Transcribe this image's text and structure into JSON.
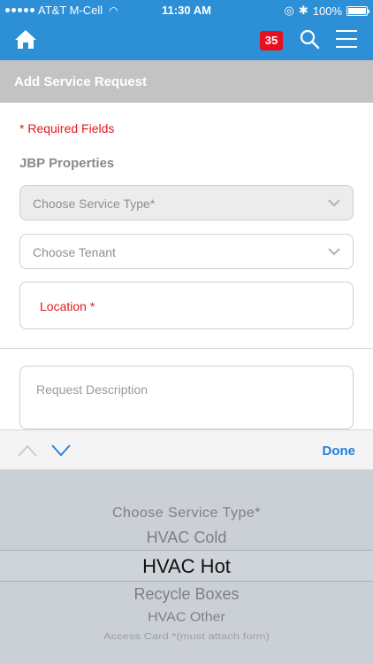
{
  "status_bar": {
    "carrier": "AT&T M-Cell",
    "time": "11:30 AM",
    "battery": "100%"
  },
  "header": {
    "notification_count": "35"
  },
  "title_bar": {
    "title": "Add Service Request"
  },
  "form": {
    "required_note": "* Required Fields",
    "company": "JBP Properties",
    "service_type_placeholder": "Choose Service Type*",
    "tenant_placeholder": "Choose Tenant",
    "location_label": "Location *",
    "description_placeholder": "Request Description"
  },
  "picker_toolbar": {
    "done_label": "Done"
  },
  "picker": {
    "options": [
      "Choose Service Type*",
      "HVAC Cold",
      "HVAC Hot",
      "Recycle Boxes",
      "HVAC Other",
      "Access Card *(must attach form)"
    ],
    "selected": "HVAC Hot"
  },
  "colors": {
    "brand_blue": "#2d8fd6",
    "badge_red": "#e8101e",
    "required_red": "#e01a1a",
    "done_blue": "#1e7fd9"
  }
}
